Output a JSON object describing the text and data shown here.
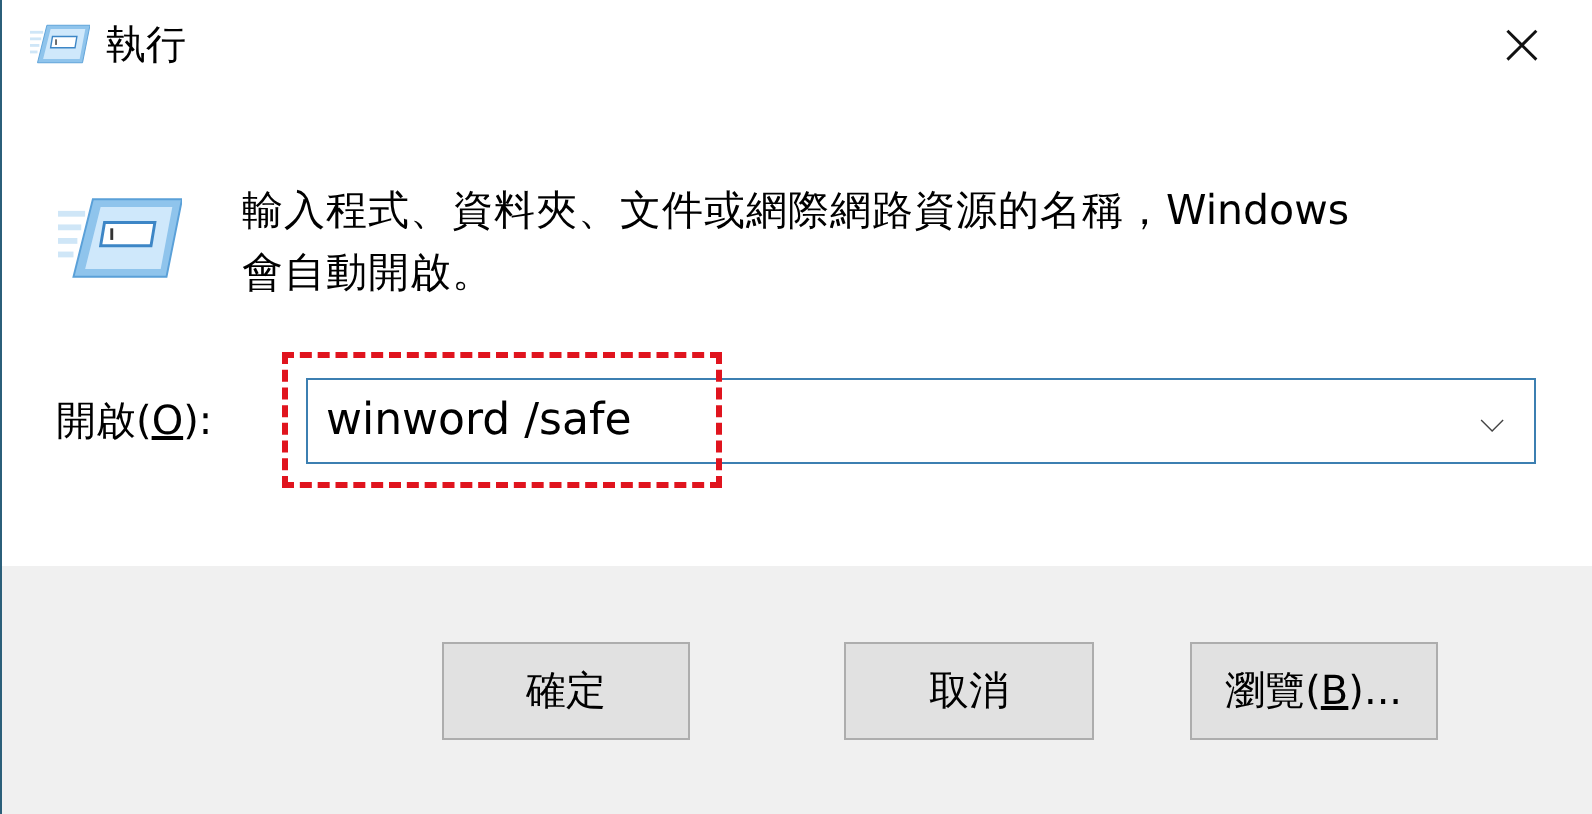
{
  "window": {
    "title": "執行",
    "close": "×"
  },
  "description": "輸入程式、資料夾、文件或網際網路資源的名稱，Windows 會自動開啟。",
  "open_field": {
    "label_before": "開啟(",
    "access_key": "O",
    "label_after": "):",
    "value": "winword /safe",
    "dropdown": "⌵",
    "highlighted": true
  },
  "buttons": [
    {
      "label_before": "確定"
    },
    {
      "label_before": "取消"
    },
    {
      "label_before": "瀏覽(",
      "access_key": "B",
      "label_after": ")..."
    }
  ]
}
